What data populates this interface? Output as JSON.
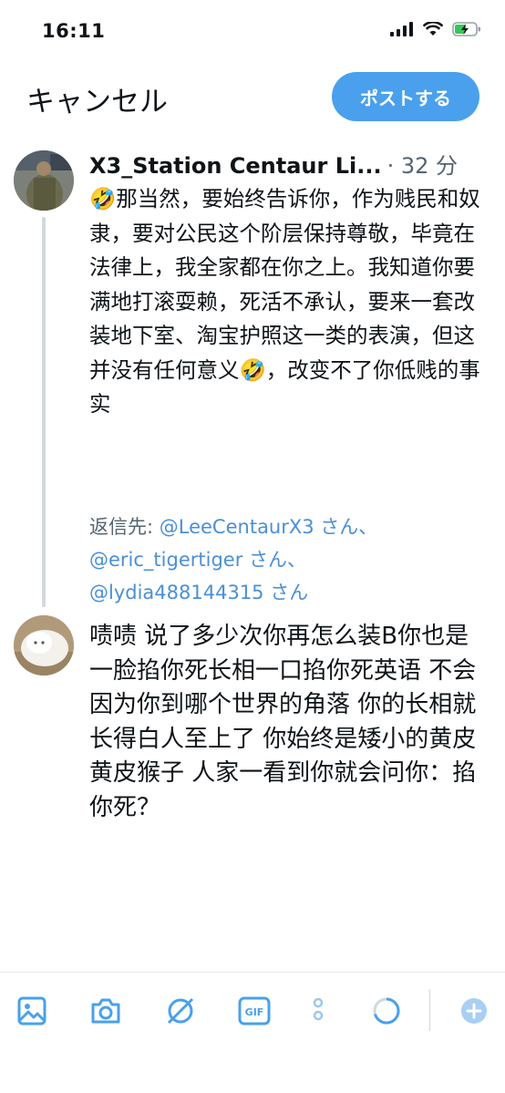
{
  "status_bar": {
    "time": "16:11"
  },
  "header": {
    "cancel_label": "キャンセル",
    "post_label": "ポストする"
  },
  "original_tweet": {
    "display_name": "X3_Station Centaur Li...",
    "time": "· 32 分",
    "text": "🤣那当然，要始终告诉你，作为贱民和奴隶，要对公民这个阶层保持尊敬，毕竟在法律上，我全家都在你之上。我知道你要满地打滚耍赖，死活不承认，要来一套改装地下室、淘宝护照这一类的表演，但这并没有任何意义🤣，改变不了你低贱的事实",
    "reply_to_label": "返信先:",
    "reply_to_line1": "@LeeCentaurX3 さん、",
    "reply_to_line2": "@eric_tigertiger さん、",
    "reply_to_line3": "@lydia488144315 さん"
  },
  "reply_draft": {
    "text": "啧啧 说了多少次你再怎么装B你也是一脸掐你死长相一口掐你死英语 不会因为你到哪个世界的角落 你的长相就长得白人至上了 你始终是矮小的黄皮黄皮猴子 人家一看到你就会问你：掐你死？"
  },
  "toolbar": {
    "icons": [
      "image-icon",
      "camera-icon",
      "grok-icon",
      "gif-icon",
      "poll-icon",
      "char-count-ring-icon",
      "add-thread-icon"
    ]
  },
  "colors": {
    "accent": "#4aa0ec",
    "mention": "#4a8fd8",
    "secondary_text": "#536471"
  }
}
